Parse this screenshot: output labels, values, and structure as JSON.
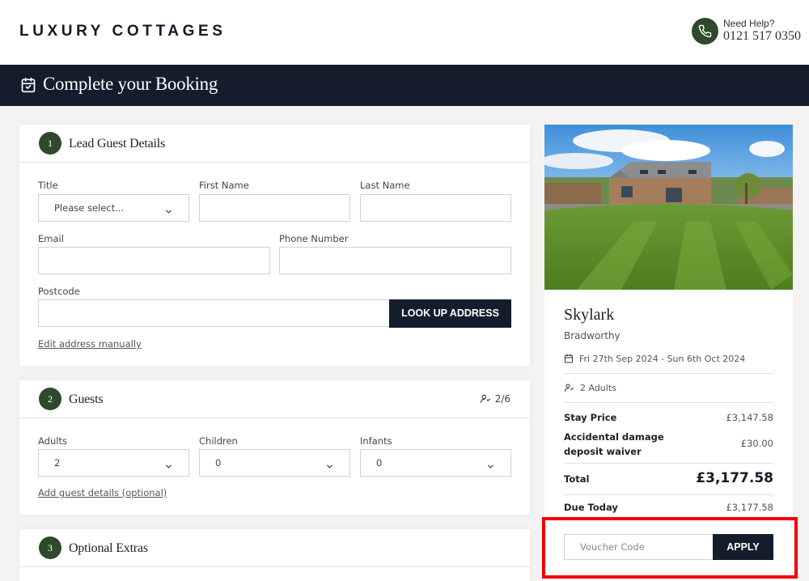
{
  "header": {
    "logo": "LUXURY COTTAGES",
    "help_title": "Need Help?",
    "help_phone": "0121 517 0350"
  },
  "banner": {
    "title": "Complete your Booking"
  },
  "lead": {
    "step": "1",
    "title": "Lead Guest Details",
    "title_label": "Title",
    "title_value": "Please select...",
    "first_name_label": "First Name",
    "last_name_label": "Last Name",
    "email_label": "Email",
    "phone_label": "Phone Number",
    "postcode_label": "Postcode",
    "lookup_button": "LOOK UP ADDRESS",
    "edit_manual_link": "Edit address manually"
  },
  "guests": {
    "step": "2",
    "title": "Guests",
    "count": "2/6",
    "adults_label": "Adults",
    "adults_value": "2",
    "children_label": "Children",
    "children_value": "0",
    "infants_label": "Infants",
    "infants_value": "0",
    "add_details_link": "Add guest details (optional)"
  },
  "extras": {
    "step": "3",
    "title": "Optional Extras"
  },
  "summary": {
    "property_name": "Skylark",
    "location": "Bradworthy",
    "dates": "Fri 27th Sep 2024 - Sun 6th Oct 2024",
    "guests": "2 Adults",
    "stay_price_label": "Stay Price",
    "stay_price": "£3,147.58",
    "deposit_label": "Accidental damage deposit waiver",
    "deposit_price": "£30.00",
    "total_label": "Total",
    "total": "£3,177.58",
    "due_today_label": "Due Today",
    "due_today": "£3,177.58",
    "voucher_placeholder": "Voucher Code",
    "apply_button": "APPLY"
  },
  "colors": {
    "navy": "#141d2b",
    "green": "#2d4a2b",
    "highlight": "#f20000"
  },
  "icons": [
    "phone-icon",
    "calendar-check-icon",
    "chevron-down-icon",
    "calendar-icon",
    "guests-icon"
  ]
}
